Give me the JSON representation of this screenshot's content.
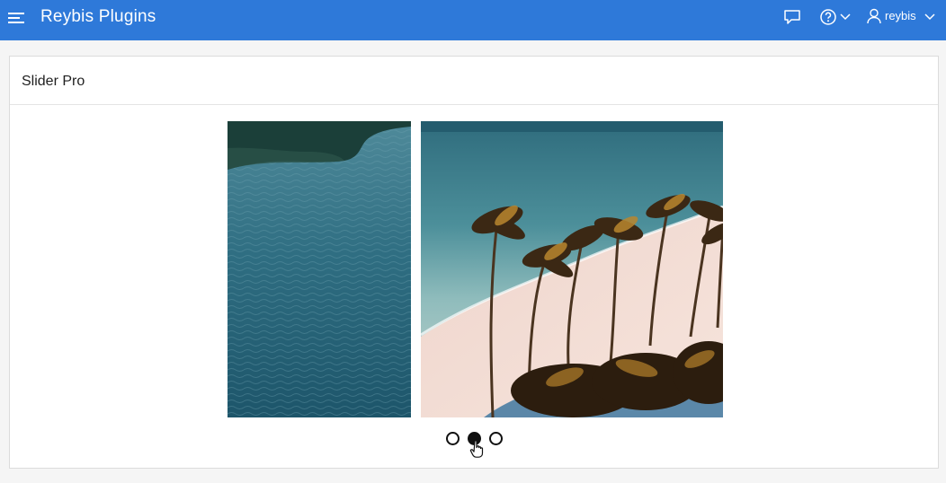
{
  "header": {
    "app_title": "Reybis Plugins",
    "menu_icon": "hamburger-menu-icon",
    "chat_icon": "chat-bubble-icon",
    "help_icon": "help-circle-icon",
    "user_icon": "user-icon",
    "username": "reybis",
    "bar_color": "#2e79d9"
  },
  "region": {
    "title": "Slider Pro"
  },
  "slider": {
    "slides": [
      {
        "name": "ocean-water-image"
      },
      {
        "name": "beach-palm-trees-image"
      }
    ],
    "dots_total": 3,
    "active_dot": 2
  }
}
